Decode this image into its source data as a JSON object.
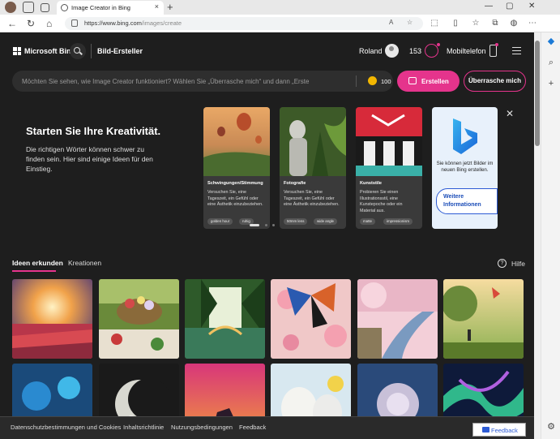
{
  "browser": {
    "tab_title": "Image Creator in Bing",
    "url_host": "https://www.bing.com",
    "url_path": "/images/create"
  },
  "header": {
    "brand": "Microsoft Bing",
    "title": "Bild-Ersteller",
    "user_name": "Roland",
    "rewards": "153",
    "mobile_label": "Mobiltelefon"
  },
  "prompt": {
    "placeholder": "Möchten Sie sehen, wie Image Creator funktioniert? Wählen Sie „Überrasche mich“ und dann „Erste",
    "boosts": "100",
    "create_label": "Erstellen",
    "surprise_label": "Überrasche mich"
  },
  "promo": {
    "title": "Starten Sie Ihre Kreativität.",
    "text": "Die richtigen Wörter können schwer zu finden sein. Hier sind einige Ideen für den Einstieg.",
    "cards": [
      {
        "category": "Schwingungen/Stimmung",
        "desc": "Versuchen Sie, eine Tageszeit, ein Gefühl oder eine Ästhetik einzubeziehen.",
        "chips": [
          "golden hour",
          "ruhig"
        ]
      },
      {
        "category": "Fotografie",
        "desc": "Versuchen Sie, eine Tageszeit, ein Gefühl oder eine Ästhetik einzubeziehen.",
        "chips": [
          "50mm lens",
          "wide angle"
        ]
      },
      {
        "category": "Kunststile",
        "desc": "Probieren Sie einen Illustrationsstil, eine Kunstepoche oder ein Material aus.",
        "chips": [
          "matte",
          "impressionism"
        ]
      }
    ],
    "bing_card_text": "Sie können jetzt Bilder im neuen Bing erstellen.",
    "bing_card_link": "Weitere Informationen"
  },
  "tabs": {
    "explore": "Ideen erkunden",
    "creations": "Kreationen",
    "help": "Hilfe"
  },
  "footer": {
    "links": [
      "Datenschutzbestimmungen und Cookies",
      "Inhaltsrichtlinie",
      "Nutzungsbedingungen",
      "Feedback"
    ],
    "feedback_button": "Feedback"
  },
  "colors": {
    "accent": "#e5348c",
    "page_bg": "#1e1e1e",
    "bing_blue": "#2d5bd4"
  }
}
